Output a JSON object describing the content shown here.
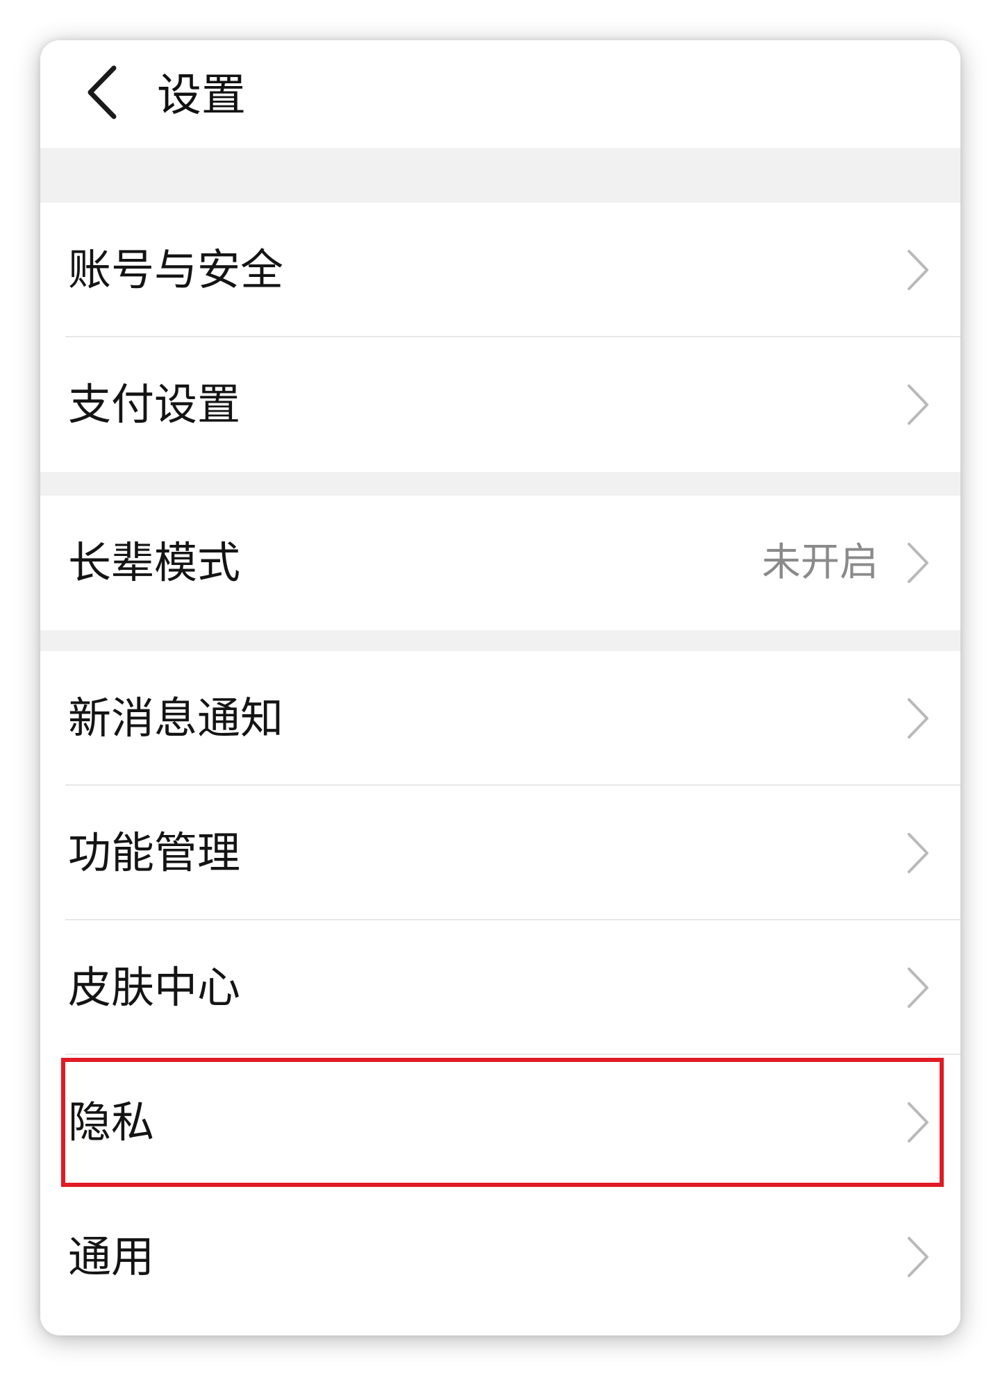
{
  "header": {
    "title": "设置",
    "back_icon": "chevron-left-icon"
  },
  "groups": [
    {
      "items": [
        {
          "label": "账号与安全",
          "icon": "chevron-right-icon"
        },
        {
          "label": "支付设置",
          "icon": "chevron-right-icon"
        }
      ]
    },
    {
      "items": [
        {
          "label": "长辈模式",
          "value": "未开启",
          "icon": "chevron-right-icon"
        }
      ]
    },
    {
      "items": [
        {
          "label": "新消息通知",
          "icon": "chevron-right-icon"
        },
        {
          "label": "功能管理",
          "icon": "chevron-right-icon"
        },
        {
          "label": "皮肤中心",
          "icon": "chevron-right-icon"
        },
        {
          "label": "隐私",
          "icon": "chevron-right-icon",
          "highlighted": true
        },
        {
          "label": "通用",
          "icon": "chevron-right-icon"
        }
      ]
    }
  ],
  "colors": {
    "highlight": "#e01b24",
    "gap_background": "#f1f1f1",
    "secondary_text": "#8a8a8a"
  }
}
